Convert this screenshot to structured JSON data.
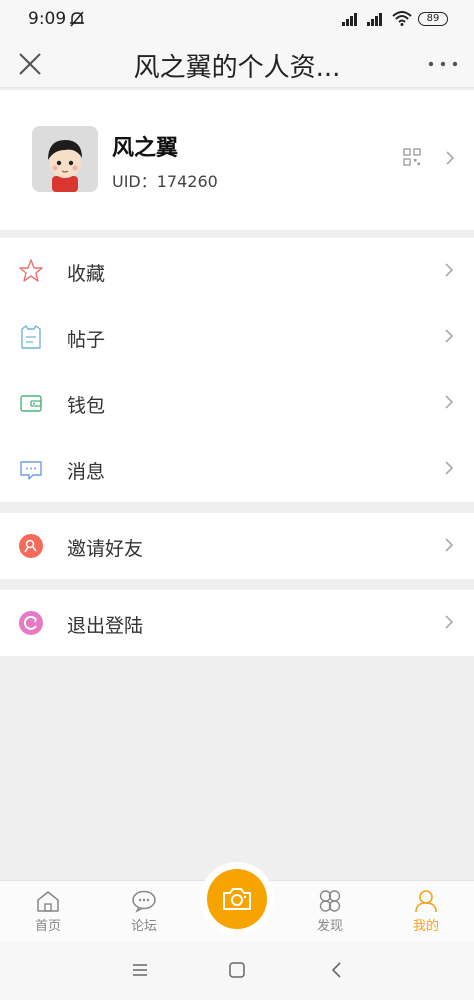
{
  "status_bar": {
    "time": "9:09",
    "battery": "89"
  },
  "header": {
    "title": "风之翼的个人资..."
  },
  "profile": {
    "name": "风之翼",
    "uid": "UID：174260"
  },
  "menu_groups": [
    {
      "items": [
        {
          "label": "收藏",
          "icon": "star-icon"
        },
        {
          "label": "帖子",
          "icon": "post-icon"
        },
        {
          "label": "钱包",
          "icon": "wallet-icon"
        },
        {
          "label": "消息",
          "icon": "message-icon"
        }
      ]
    },
    {
      "items": [
        {
          "label": "邀请好友",
          "icon": "invite-icon"
        }
      ]
    },
    {
      "items": [
        {
          "label": "退出登陆",
          "icon": "logout-icon"
        }
      ]
    }
  ],
  "tab_bar": {
    "tabs": [
      {
        "label": "首页",
        "icon": "home-icon"
      },
      {
        "label": "论坛",
        "icon": "forum-icon"
      },
      {
        "label": "发现",
        "icon": "discover-icon"
      },
      {
        "label": "我的",
        "icon": "profile-icon"
      }
    ],
    "active": "我的",
    "accent": "#f7a300"
  }
}
